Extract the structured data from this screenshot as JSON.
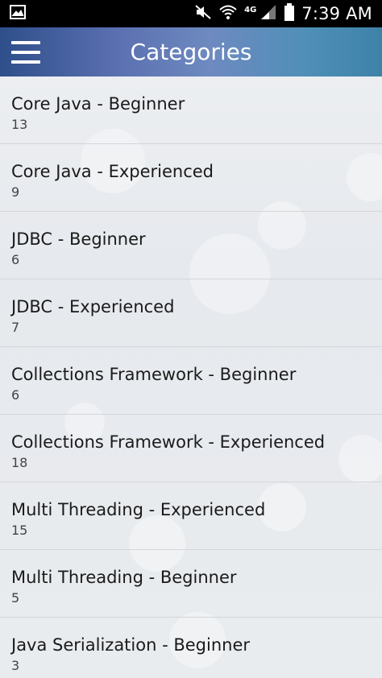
{
  "status_bar": {
    "time": "7:39 AM",
    "network": "4G"
  },
  "action_bar": {
    "title": "Categories"
  },
  "categories": [
    {
      "title": "Core Java - Beginner",
      "count": "13"
    },
    {
      "title": "Core Java - Experienced",
      "count": "9"
    },
    {
      "title": "JDBC - Beginner",
      "count": "6"
    },
    {
      "title": "JDBC - Experienced",
      "count": "7"
    },
    {
      "title": "Collections Framework - Beginner",
      "count": "6"
    },
    {
      "title": "Collections Framework - Experienced",
      "count": "18"
    },
    {
      "title": "Multi Threading - Experienced",
      "count": "15"
    },
    {
      "title": "Multi Threading - Beginner",
      "count": "5"
    },
    {
      "title": "Java Serialization - Beginner",
      "count": "3"
    }
  ]
}
